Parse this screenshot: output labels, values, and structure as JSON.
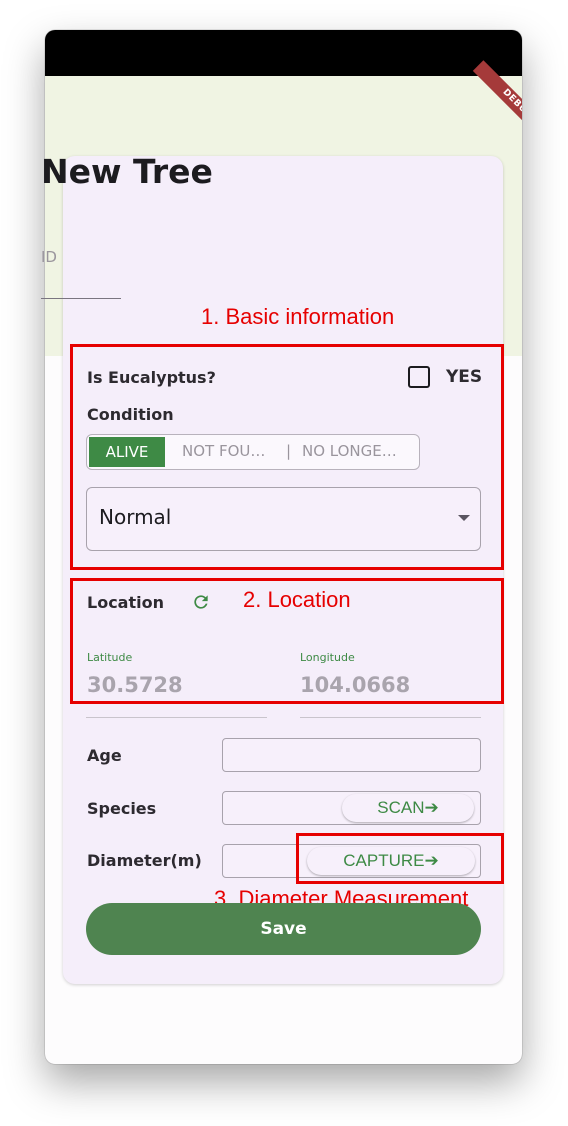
{
  "app": {
    "debug_banner": "DEBUG",
    "title": "New Tree"
  },
  "form": {
    "id_label": "ID",
    "is_eucalyptus_label": "Is Eucalyptus?",
    "yes_label": "YES",
    "condition_label": "Condition",
    "condition_options": [
      "ALIVE",
      "NOT FOU…",
      "NO LONGE…"
    ],
    "selected_condition": "ALIVE",
    "health_value": "Normal",
    "location_label": "Location",
    "latitude_label": "Latitude",
    "latitude_value": "30.5728",
    "longitude_label": "Longitude",
    "longitude_value": "104.0668",
    "age_label": "Age",
    "species_label": "Species",
    "scan_button": "SCAN➔",
    "diameter_label": "Diameter(m)",
    "capture_button": "CAPTURE➔",
    "save_button": "Save"
  },
  "annotations": {
    "basic_info": "1. Basic information",
    "location": "2. Location",
    "diameter": "3. Diameter Measurement"
  },
  "colors": {
    "accent_green": "#3e8a45",
    "save_green": "#4f8450",
    "annotation_red": "#e60000",
    "card_bg": "#f5eefa"
  }
}
